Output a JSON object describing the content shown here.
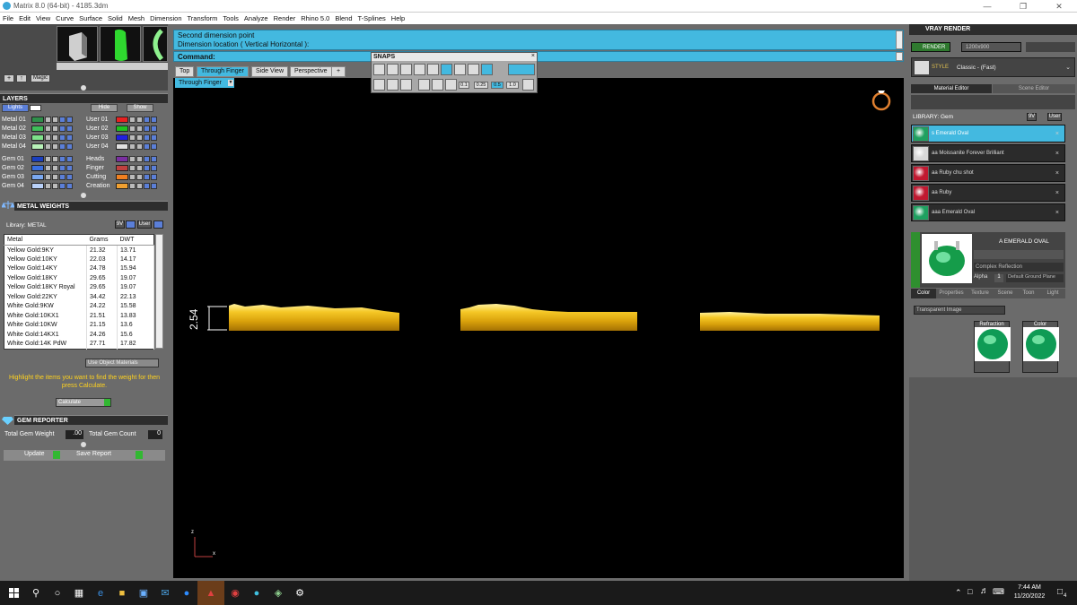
{
  "window": {
    "title": "Matrix 8.0 (64-bit) - 4185.3dm"
  },
  "menu": [
    "File",
    "Edit",
    "View",
    "Curve",
    "Surface",
    "Solid",
    "Mesh",
    "Dimension",
    "Transform",
    "Tools",
    "Analyze",
    "Render",
    "Rhino 5.0",
    "Blend",
    "T-Splines",
    "Help"
  ],
  "left_toolbar": {
    "magic_label": "Magic"
  },
  "layers": {
    "title": "LAYERS",
    "lights_label": "Lights",
    "hide_label": "Hide",
    "show_label": "Show",
    "left_rows": [
      {
        "name": "Metal 01",
        "color": "#2f8f4a"
      },
      {
        "name": "Metal 02",
        "color": "#3fbf5a"
      },
      {
        "name": "Metal 03",
        "color": "#7ee28a"
      },
      {
        "name": "Metal 04",
        "color": "#b9f2b9"
      },
      {
        "name": "Gem 01",
        "color": "#1a3fbf"
      },
      {
        "name": "Gem 02",
        "color": "#3a6fe0"
      },
      {
        "name": "Gem 03",
        "color": "#7aa8f0"
      },
      {
        "name": "Gem 04",
        "color": "#b8d0f8"
      }
    ],
    "right_rows": [
      {
        "name": "User 01",
        "color": "#e82020"
      },
      {
        "name": "User 02",
        "color": "#20c020"
      },
      {
        "name": "User 03",
        "color": "#2020e0"
      },
      {
        "name": "User 04",
        "color": "#e0e0e0"
      },
      {
        "name": "Heads",
        "color": "#7a2fa0"
      },
      {
        "name": "Finger",
        "color": "#c04040"
      },
      {
        "name": "Cutting",
        "color": "#f08020"
      },
      {
        "name": "Creation",
        "color": "#f0a030"
      }
    ]
  },
  "metal_weights": {
    "title": "METAL WEIGHTS",
    "library_label": "Library: METAL",
    "tag_9v": "9V",
    "tag_user": "User",
    "columns": [
      "Metal",
      "Grams",
      "DWT"
    ],
    "rows": [
      [
        "Yellow Gold:9KY",
        "21.32",
        "13.71"
      ],
      [
        "Yellow Gold:10KY",
        "22.03",
        "14.17"
      ],
      [
        "Yellow Gold:14KY",
        "24.78",
        "15.94"
      ],
      [
        "Yellow Gold:18KY",
        "29.65",
        "19.07"
      ],
      [
        "Yellow Gold:18KY Royal",
        "29.65",
        "19.07"
      ],
      [
        "Yellow Gold:22KY",
        "34.42",
        "22.13"
      ],
      [
        "White Gold:9KW",
        "24.22",
        "15.58"
      ],
      [
        "White Gold:10KX1",
        "21.51",
        "13.83"
      ],
      [
        "White Gold:10KW",
        "21.15",
        "13.6"
      ],
      [
        "White Gold:14KX1",
        "24.26",
        "15.6"
      ],
      [
        "White Gold:14K PdW",
        "27.71",
        "17.82"
      ]
    ],
    "use_object_materials": "Use Object Materials",
    "hint": "Highlight the items you want to find the weight for then press Calculate.",
    "calculate_label": "Calculate"
  },
  "gem_reporter": {
    "title": "GEM REPORTER",
    "total_weight_label": "Total Gem Weight",
    "total_weight_value": ".00",
    "total_count_label": "Total Gem Count",
    "total_count_value": "0",
    "update_label": "Update",
    "save_report_label": "Save Report"
  },
  "command": {
    "line1": "Second dimension point",
    "line2": "Dimension location ( Vertical  Horizontal ):",
    "label": "Command:"
  },
  "viewport_tabs": [
    "Top",
    "Through Finger",
    "Side View",
    "Perspective"
  ],
  "active_view_label": "Through Finger",
  "snaps": {
    "title": "SNAPS",
    "values": [
      "0.1",
      "0.25",
      "0.5",
      "1.0"
    ]
  },
  "dimension_text": "2.54",
  "axis": {
    "x": "x",
    "z": "z"
  },
  "vray": {
    "title": "VRAY RENDER",
    "render_label": "RENDER",
    "resolution": "1200x900",
    "style_prefix": "STYLE",
    "style_value": "Classic - (Fast)",
    "tabs": [
      "Material Editor",
      "Scene Editor"
    ],
    "library_label": "LIBRARY: Gem",
    "tag_9v": "9V",
    "tag_user": "User",
    "materials": [
      {
        "name": "s Emerald Oval",
        "color": "#1fa060",
        "selected": true
      },
      {
        "name": "aa Moissanite Forever Brilliant",
        "color": "#d8d8d8",
        "selected": false
      },
      {
        "name": "aa Ruby chu shot",
        "color": "#c01830",
        "selected": false
      },
      {
        "name": "aa Ruby",
        "color": "#c01830",
        "selected": false
      },
      {
        "name": "aaa Emerald Oval",
        "color": "#1fa060",
        "selected": false
      }
    ],
    "preview_title": "A EMERALD OVAL",
    "complex_reflection": "Complex Reflection",
    "alpha_label": "Alpha",
    "alpha_value": "1",
    "ground_plane": "Default Ground Plane",
    "subtabs": [
      "Color",
      "Properties",
      "Texture",
      "Scene",
      "Toon",
      "Light"
    ],
    "transparent_image": "Transparent Image",
    "refraction_label": "Refraction",
    "color_label": "Color"
  },
  "taskbar": {
    "time": "7:44 AM",
    "date": "11/20/2022",
    "notification_count": "4"
  }
}
